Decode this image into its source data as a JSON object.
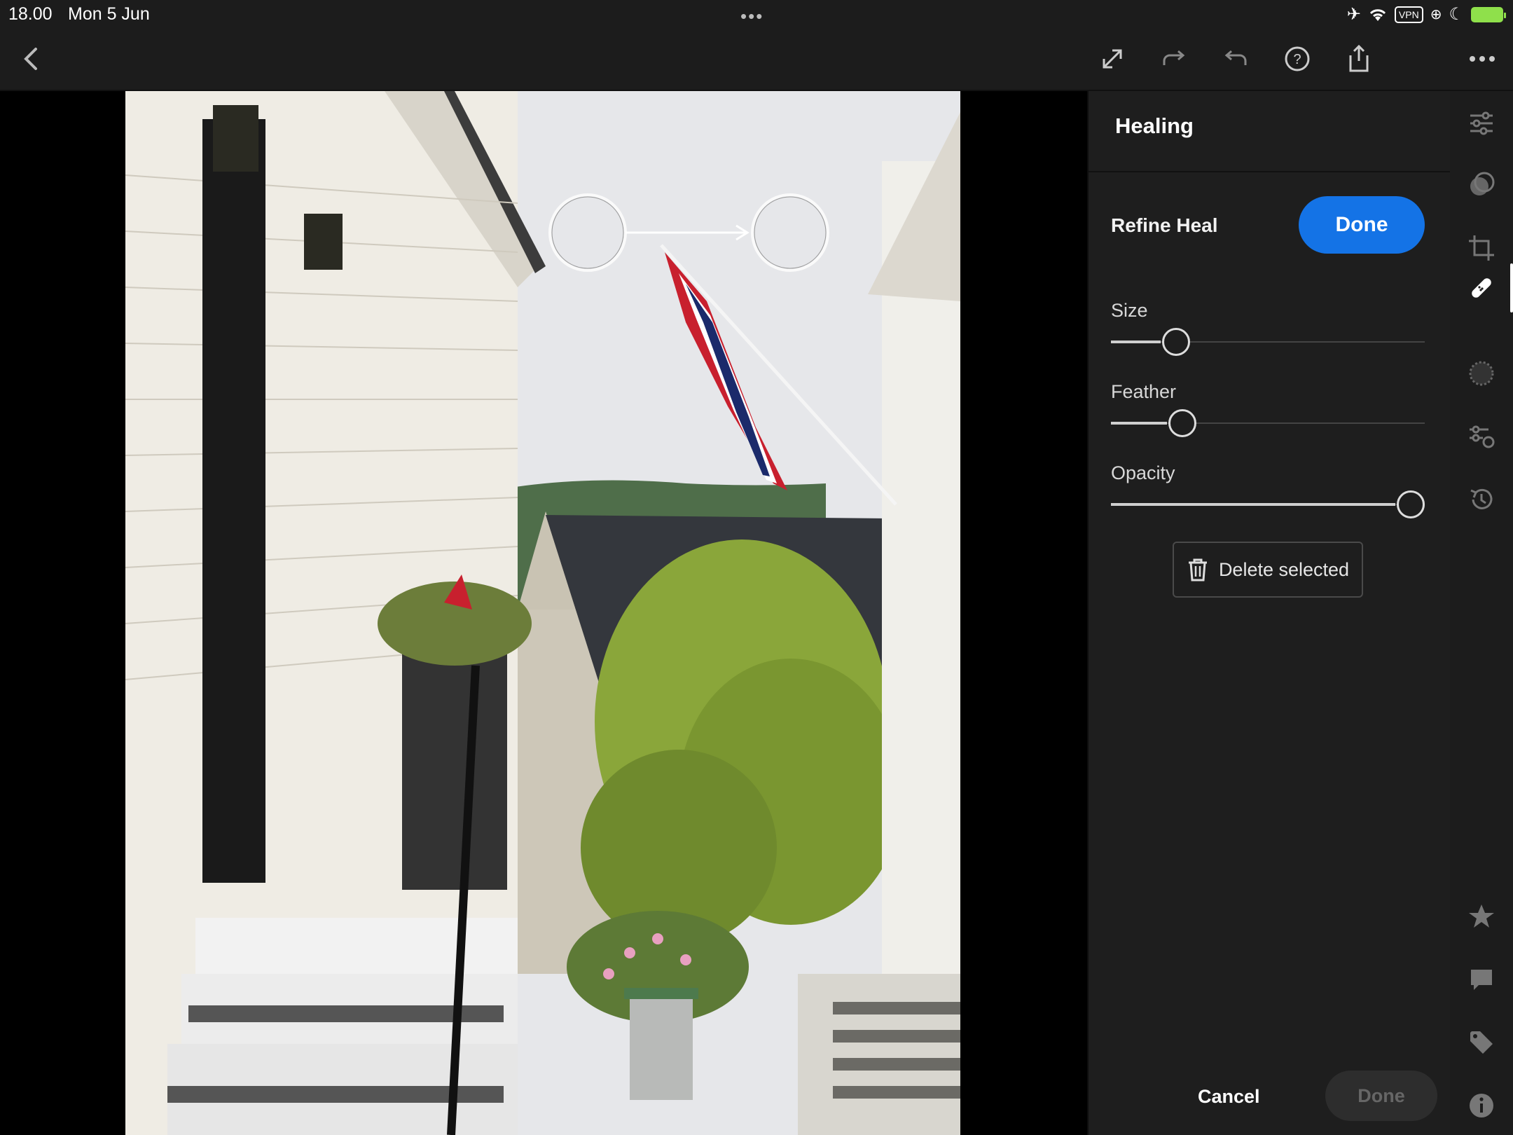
{
  "status_bar": {
    "time": "18.00",
    "date": "Mon 5 Jun",
    "vpn_label": "VPN"
  },
  "toolbar": {
    "icons": [
      "back-icon",
      "expand-icon",
      "redo-icon",
      "undo-icon",
      "help-icon",
      "share-icon",
      "more-icon"
    ]
  },
  "panel": {
    "title": "Healing",
    "refine_label": "Refine Heal",
    "done_label": "Done",
    "sliders": [
      {
        "label": "Size",
        "value": 0.18
      },
      {
        "label": "Feather",
        "value": 0.2
      },
      {
        "label": "Opacity",
        "value": 1.0
      }
    ],
    "delete_label": "Delete selected",
    "cancel_label": "Cancel",
    "footer_done_label": "Done"
  },
  "rail": {
    "tools": [
      "edit-sliders-icon",
      "masking-icon",
      "crop-icon",
      "healing-icon",
      "selective-icon",
      "presets-icon",
      "history-icon"
    ],
    "active_tool": "healing-icon",
    "bottom": [
      "rating-star-icon",
      "comment-icon",
      "tag-icon",
      "info-icon"
    ]
  },
  "colors": {
    "accent": "#1473e6",
    "panel_bg": "#1e1e1e",
    "toolbar_bg": "#1c1c1c"
  }
}
